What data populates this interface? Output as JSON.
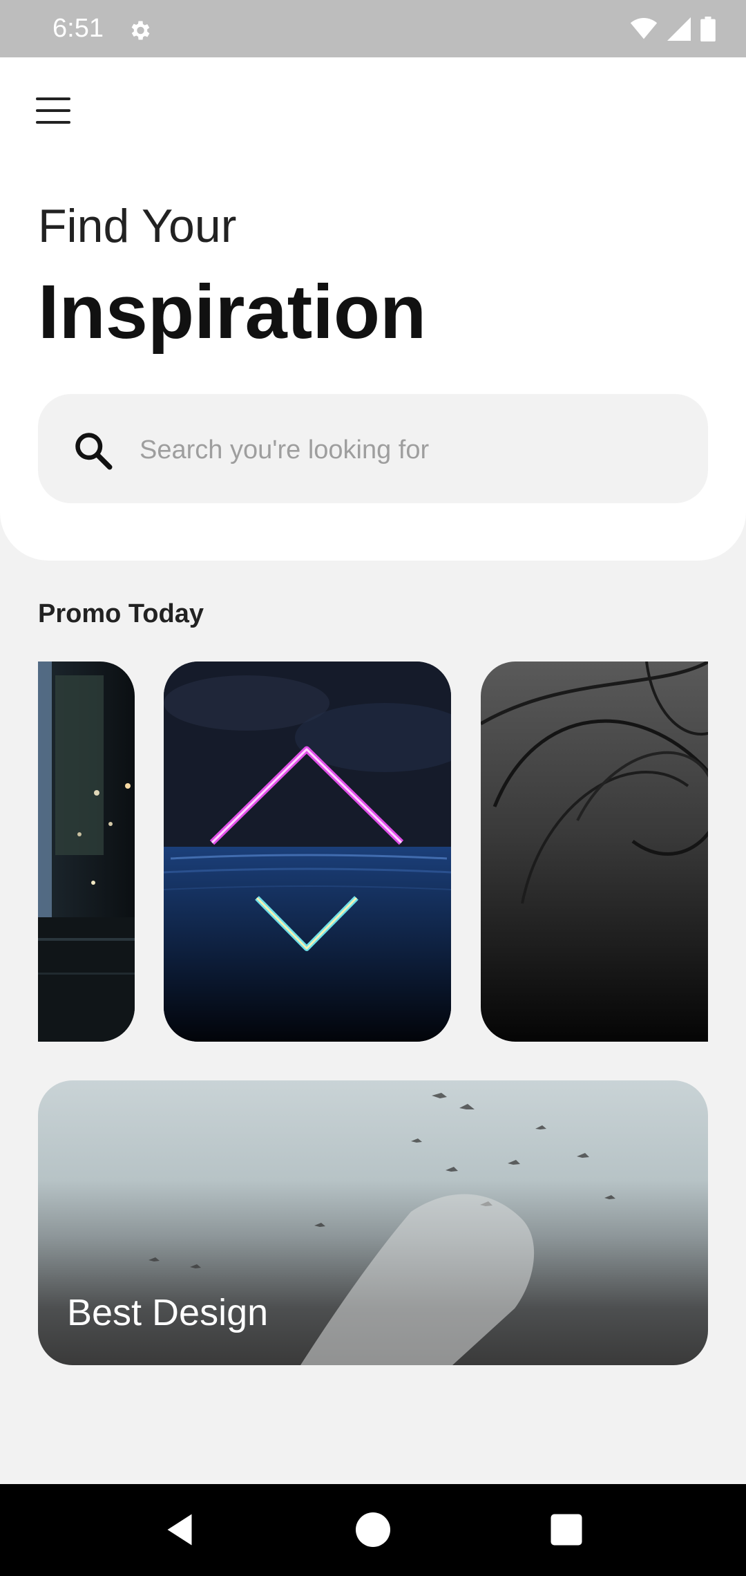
{
  "status_bar": {
    "time": "6:51"
  },
  "header": {
    "title_line1": "Find Your",
    "title_line2": "Inspiration"
  },
  "search": {
    "placeholder": "Search you're looking for",
    "value": ""
  },
  "promo": {
    "section_title": "Promo Today",
    "cards": [
      "city-street-night",
      "neon-diamond-water",
      "abstract-dark-lines"
    ]
  },
  "featured": {
    "title": "Best Design"
  },
  "icons": {
    "menu": "hamburger-menu-icon",
    "search": "search-icon",
    "settings": "gear-icon",
    "wifi": "wifi-icon",
    "signal": "signal-icon",
    "battery": "battery-icon",
    "back": "back-triangle-icon",
    "home": "home-circle-icon",
    "recents": "recents-square-icon"
  },
  "colors": {
    "background": "#f2f2f2",
    "header": "#ffffff",
    "status_bar": "#bdbdbd",
    "nav_bar": "#000000"
  }
}
